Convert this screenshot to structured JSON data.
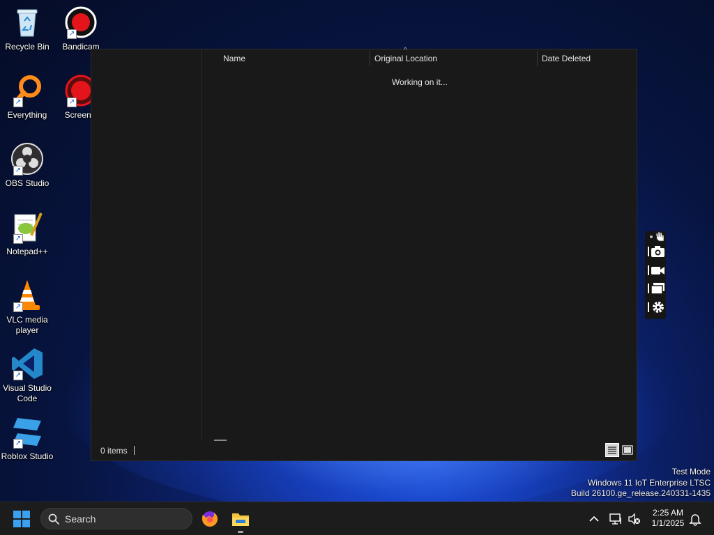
{
  "desktop": {
    "icons": [
      {
        "label": "Recycle Bin"
      },
      {
        "label": "Bandicam"
      },
      {
        "label": "Everything"
      },
      {
        "label": "ScreenR"
      },
      {
        "label": "OBS Studio"
      },
      {
        "label": "Notepad++"
      },
      {
        "label": "VLC media player"
      },
      {
        "label": "Visual Studio Code"
      },
      {
        "label": "Roblox Studio"
      }
    ]
  },
  "explorer": {
    "columns": [
      {
        "label": "Name"
      },
      {
        "label": "Original Location"
      },
      {
        "label": "Date Deleted"
      }
    ],
    "loading_text": "Working on it...",
    "status": {
      "items_count": "0 items"
    }
  },
  "watermark": {
    "line1": "Test Mode",
    "line2": "Windows 11 IoT Enterprise LTSC",
    "line3": "Build 26100.ge_release.240331-1435"
  },
  "taskbar": {
    "search_label": "Search",
    "time": "2:25 AM",
    "date": "1/1/2025"
  },
  "colors": {
    "accent": "#1a73e8",
    "window_bg": "#191919",
    "taskbar_bg": "#1c1c1c"
  }
}
